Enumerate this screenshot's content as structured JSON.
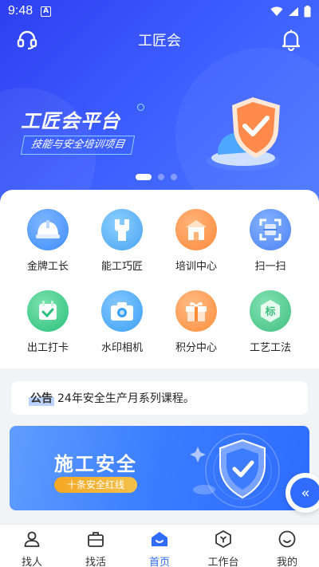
{
  "status_bar": {
    "time": "9:48",
    "notification_icon": "A"
  },
  "header": {
    "title": "工匠会",
    "left_icon": "headset-icon",
    "right_icon": "bell-icon"
  },
  "banner": {
    "title": "工匠会平台",
    "subtitle": "技能与安全培训项目",
    "page_count": 3,
    "active_page": 1
  },
  "grid": [
    {
      "label": "金牌工长",
      "icon": "helmet-icon",
      "color": "#3f8cff"
    },
    {
      "label": "能工巧匠",
      "icon": "wrench-icon",
      "color": "#4aa3f2"
    },
    {
      "label": "培训中心",
      "icon": "building-icon",
      "color": "#ff8a3c"
    },
    {
      "label": "扫一扫",
      "icon": "scan-icon",
      "color": "#4b82f5"
    },
    {
      "label": "出工打卡",
      "icon": "calendar-check-icon",
      "color": "#28c07a"
    },
    {
      "label": "水印相机",
      "icon": "camera-icon",
      "color": "#3aa0f5"
    },
    {
      "label": "积分中心",
      "icon": "gift-icon",
      "color": "#ff8d3a"
    },
    {
      "label": "工艺工法",
      "icon": "tag-icon",
      "color": "#3fbf7f",
      "badge": "标"
    }
  ],
  "notice": {
    "tag": "公告",
    "text": "24年安全生产月系列课程。"
  },
  "safety_banner": {
    "title": "施工安全",
    "pill": "十条安全红线"
  },
  "float_button": {
    "icon": "double-chevron-left-icon",
    "glyph": "«"
  },
  "tabbar": {
    "active": 2,
    "items": [
      {
        "label": "找人",
        "icon": "person-icon"
      },
      {
        "label": "找活",
        "icon": "briefcase-icon"
      },
      {
        "label": "首页",
        "icon": "home-icon"
      },
      {
        "label": "工作台",
        "icon": "workbench-icon"
      },
      {
        "label": "我的",
        "icon": "smile-icon"
      }
    ]
  },
  "colors": {
    "primary": "#2f6cff",
    "hero_start": "#2d3ff0",
    "hero_end": "#4b78ff"
  }
}
